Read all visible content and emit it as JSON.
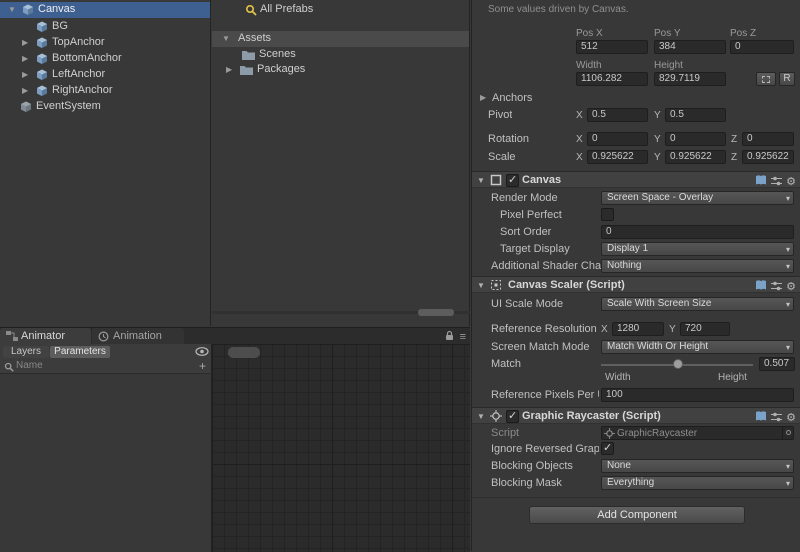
{
  "icons": {
    "foldout_open": "▼",
    "foldout_closed": "▶",
    "dropdown_caret": "▾",
    "check": "✓",
    "gear": "⚙",
    "menu": "≡",
    "plus": "+"
  },
  "colors": {
    "selection_blue": "#3e6091",
    "inactive_selection_gray": "#4a4a4a",
    "panel_bg": "#383838",
    "field_bg": "#2a2a2a",
    "search_icon_yellow": "#e5c545"
  },
  "hierarchy": {
    "items": [
      {
        "label": "Canvas"
      },
      {
        "label": "BG"
      },
      {
        "label": "TopAnchor"
      },
      {
        "label": "BottomAnchor"
      },
      {
        "label": "LeftAnchor"
      },
      {
        "label": "RightAnchor"
      },
      {
        "label": "EventSystem"
      }
    ]
  },
  "project": {
    "favorites": [
      {
        "label": "All Prefabs"
      }
    ],
    "folders": [
      {
        "label": "Assets"
      },
      {
        "label": "Scenes"
      },
      {
        "label": "Packages"
      }
    ]
  },
  "animator": {
    "tabs": [
      {
        "label": "Animator"
      },
      {
        "label": "Animation"
      }
    ],
    "layers_button": "Layers",
    "parameters_button": "Parameters",
    "search_placeholder": "Name"
  },
  "inspector": {
    "notice": "Some values driven by Canvas.",
    "rect_transform": {
      "headers": {
        "pos_x": "Pos X",
        "pos_y": "Pos Y",
        "pos_z": "Pos Z",
        "width": "Width",
        "height": "Height"
      },
      "pos": {
        "x": "512",
        "y": "384",
        "z": "0"
      },
      "size": {
        "width": "1106.282",
        "height": "829.7119"
      },
      "raw_edit_button": "R",
      "anchors_label": "Anchors",
      "pivot_label": "Pivot",
      "pivot": {
        "x": "0.5",
        "y": "0.5"
      },
      "rotation_label": "Rotation",
      "rotation": {
        "x": "0",
        "y": "0",
        "z": "0"
      },
      "scale_label": "Scale",
      "scale": {
        "x": "0.925622",
        "y": "0.925622",
        "z": "0.925622"
      },
      "axis": {
        "x": "X",
        "y": "Y",
        "z": "Z"
      }
    },
    "canvas": {
      "title": "Canvas",
      "render_mode_label": "Render Mode",
      "render_mode_value": "Screen Space - Overlay",
      "pixel_perfect_label": "Pixel Perfect",
      "sort_order_label": "Sort Order",
      "sort_order_value": "0",
      "target_display_label": "Target Display",
      "target_display_value": "Display 1",
      "additional_shader_label": "Additional Shader Cha",
      "additional_shader_value": "Nothing"
    },
    "canvas_scaler": {
      "title": "Canvas Scaler (Script)",
      "ui_scale_mode_label": "UI Scale Mode",
      "ui_scale_mode_value": "Scale With Screen Size",
      "reference_resolution_label": "Reference Resolution",
      "reference_resolution": {
        "x": "1280",
        "y": "720"
      },
      "screen_match_mode_label": "Screen Match Mode",
      "screen_match_mode_value": "Match Width Or Height",
      "match_label": "Match",
      "match_value": "0.507",
      "match_min_label": "Width",
      "match_max_label": "Height",
      "reference_ppu_label": "Reference Pixels Per U",
      "reference_ppu_value": "100"
    },
    "graphic_raycaster": {
      "title": "Graphic Raycaster (Script)",
      "script_label": "Script",
      "script_value": "GraphicRaycaster",
      "ignore_reversed_label": "Ignore Reversed Graph",
      "blocking_objects_label": "Blocking Objects",
      "blocking_objects_value": "None",
      "blocking_mask_label": "Blocking Mask",
      "blocking_mask_value": "Everything"
    },
    "add_component_button": "Add Component"
  }
}
